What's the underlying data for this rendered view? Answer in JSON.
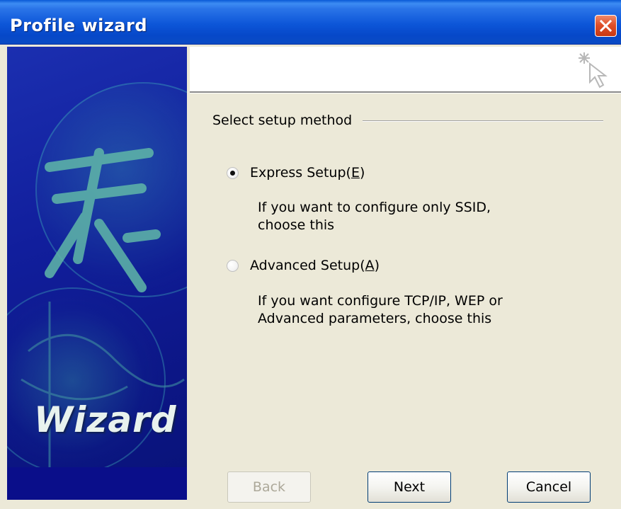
{
  "window": {
    "title": "Profile wizard",
    "close_icon": "close-icon"
  },
  "banner": {
    "text": "Wizard"
  },
  "header": {
    "icon": "wizard-wand-icon"
  },
  "content": {
    "group_label": "Select setup method",
    "options": [
      {
        "label_prefix": "Express Setup(",
        "accel": "E",
        "label_suffix": ")",
        "selected": true,
        "description_lines": [
          "If you want to configure only SSID,",
          "choose this"
        ]
      },
      {
        "label_prefix": "Advanced Setup(",
        "accel": "A",
        "label_suffix": ")",
        "selected": false,
        "description_lines": [
          "If you want configure TCP/IP, WEP or",
          "Advanced parameters, choose this"
        ]
      }
    ]
  },
  "buttons": {
    "back": {
      "label": "Back",
      "enabled": false
    },
    "next": {
      "label": "Next",
      "enabled": true
    },
    "cancel": {
      "label": "Cancel",
      "enabled": true
    }
  },
  "colors": {
    "titlebar": "#0a4bc4",
    "banner": "#111e9c",
    "dialog_bg": "#ece9d8"
  }
}
